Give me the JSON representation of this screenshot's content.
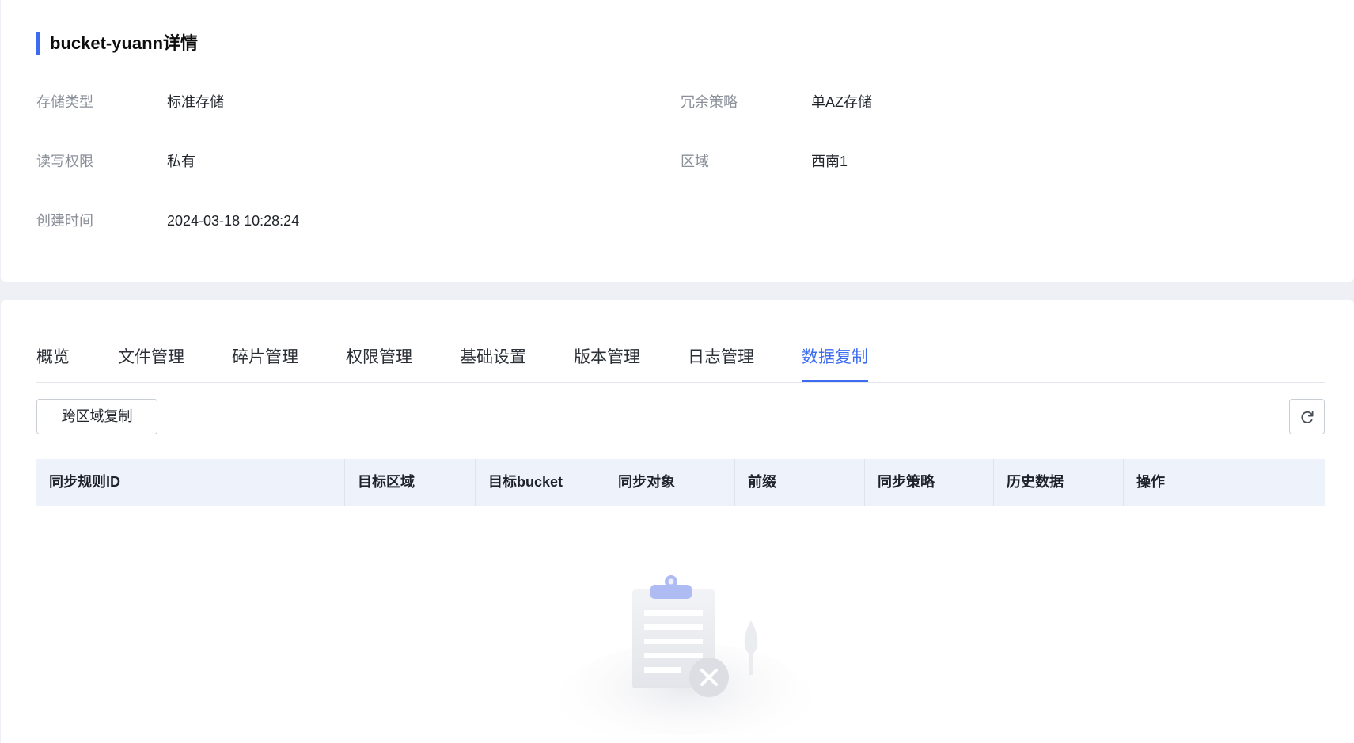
{
  "detail": {
    "title": "bucket-yuann详情",
    "fields": {
      "storage_type": {
        "label": "存储类型",
        "value": "标准存储"
      },
      "redundancy": {
        "label": "冗余策略",
        "value": "单AZ存储"
      },
      "access": {
        "label": "读写权限",
        "value": "私有"
      },
      "region": {
        "label": "区域",
        "value": "西南1"
      },
      "created": {
        "label": "创建时间",
        "value": "2024-03-18 10:28:24"
      }
    }
  },
  "tabs": [
    {
      "label": "概览"
    },
    {
      "label": "文件管理"
    },
    {
      "label": "碎片管理"
    },
    {
      "label": "权限管理"
    },
    {
      "label": "基础设置"
    },
    {
      "label": "版本管理"
    },
    {
      "label": "日志管理"
    },
    {
      "label": "数据复制",
      "active": true
    }
  ],
  "toolbar": {
    "cross_region_label": "跨区域复制",
    "refresh_icon": "refresh-icon"
  },
  "table": {
    "columns": [
      "同步规则ID",
      "目标区域",
      "目标bucket",
      "同步对象",
      "前缀",
      "同步策略",
      "历史数据",
      "操作"
    ]
  },
  "colors": {
    "accent": "#3c6cf0",
    "page_bg": "#eef0f5",
    "table_header_bg": "#eef2fb"
  }
}
